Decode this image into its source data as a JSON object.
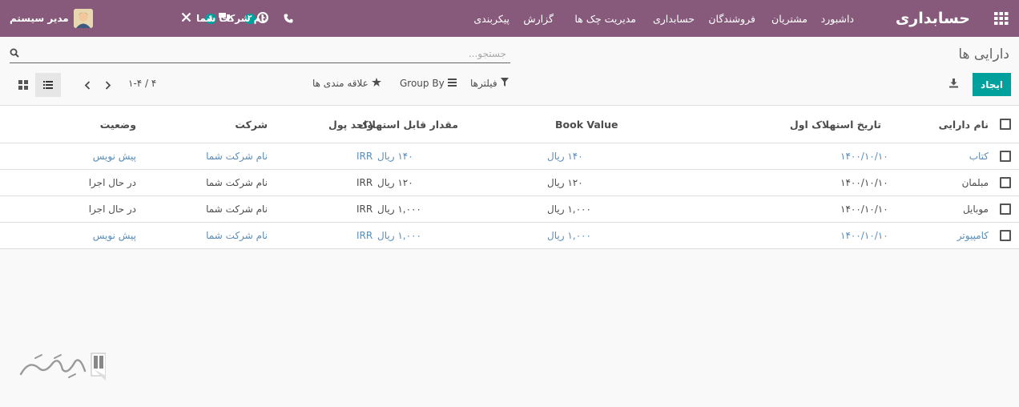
{
  "topbar": {
    "app_title": "حسابداری",
    "menu": [
      "داشبورد",
      "مشتریان",
      "فروشندگان",
      "حسابداری",
      "مدیریت چک ها",
      "گزارش",
      "پیکربندی"
    ],
    "company_name": "نام شرکت شما",
    "user_name": "مدیر سیستم",
    "activity_badge": "۲",
    "messages_badge": "۶"
  },
  "page": {
    "breadcrumb": "دارایی ها",
    "search_placeholder": "جستجو...",
    "create_label": "ایجاد",
    "filters_label": "فیلترها",
    "groupby_label": "Group By",
    "favorites_label": "علاقه مندی ها",
    "pager": "۱-۴ / ۴"
  },
  "table": {
    "headers": {
      "name": "نام دارایی",
      "first_date": "تاریخ استهلاک اول",
      "book_value": "Book Value",
      "depreciable": "مقدار قابل استهلاک",
      "currency": "واحد پول",
      "company": "شرکت",
      "status": "وضعیت"
    },
    "rows": [
      {
        "name": "کتاب",
        "first_date": "۱۴۰۰/۱۰/۱۰",
        "book_value": "۱۴۰ ریال",
        "depreciable": "۱۴۰ ریال",
        "currency": "IRR",
        "company": "نام شرکت شما",
        "status": "پیش نویس",
        "state": "draft"
      },
      {
        "name": "مبلمان",
        "first_date": "۱۴۰۰/۱۰/۱۰",
        "book_value": "۱۲۰ ریال",
        "depreciable": "۱۲۰ ریال",
        "currency": "IRR",
        "company": "نام شرکت شما",
        "status": "در حال اجرا",
        "state": "run"
      },
      {
        "name": "موبایل",
        "first_date": "۱۴۰۰/۱۰/۱۰",
        "book_value": "۱,۰۰۰ ریال",
        "depreciable": "۱,۰۰۰ ریال",
        "currency": "IRR",
        "company": "نام شرکت شما",
        "status": "در حال اجرا",
        "state": "run"
      },
      {
        "name": "کامپیوتر",
        "first_date": "۱۴۰۰/۱۰/۱۰",
        "book_value": "۱,۰۰۰ ریال",
        "depreciable": "۱,۰۰۰ ریال",
        "currency": "IRR",
        "company": "نام شرکت شما",
        "status": "پیش نویس",
        "state": "draft"
      }
    ]
  },
  "icons": {
    "apps": "apps-grid-icon",
    "search": "search-icon",
    "download": "download-icon",
    "filter": "filter-icon",
    "groupby": "groupby-icon",
    "favorite": "star-icon",
    "prev": "chevron-left-icon",
    "next": "chevron-right-icon",
    "list_view": "list-view-icon",
    "kanban_view": "kanban-view-icon"
  },
  "colors": {
    "topbar": "#875a7b",
    "primary": "#00a09d",
    "draft_text": "#5b8db8"
  }
}
